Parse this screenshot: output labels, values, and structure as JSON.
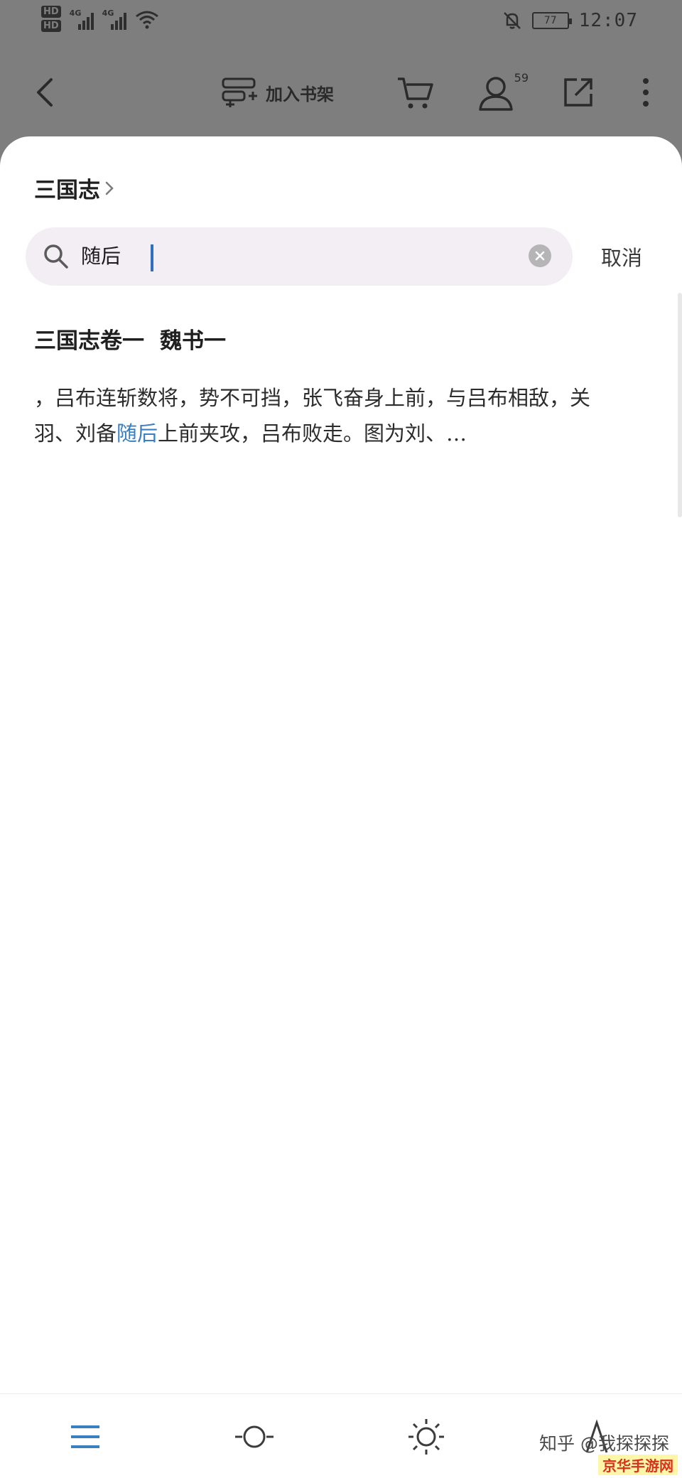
{
  "status_bar": {
    "hd1": "HD",
    "hd2": "HD",
    "net1": "4G",
    "net2": "4G",
    "battery": "77",
    "time": "12:07",
    "icons": [
      "signal-icon",
      "wifi-icon",
      "mute-bell-icon",
      "battery-icon"
    ]
  },
  "top_bar": {
    "add_shelf_label": "加入书架",
    "user_badge": "59",
    "icons": [
      "back-icon",
      "add-shelf-icon",
      "cart-icon",
      "user-icon",
      "share-icon",
      "more-icon"
    ]
  },
  "sheet": {
    "book_title": "三国志",
    "search": {
      "value": "随后",
      "cancel_label": "取消"
    },
    "result": {
      "title_part1": "三国志卷一",
      "title_part2": "魏书一",
      "snippet_before": "，吕布连斩数将，势不可挡，张飞奋身上前，与吕布相敌，关羽、刘备",
      "snippet_highlight": "随后",
      "snippet_after": "上前夹攻，吕布败走。图为刘、…"
    }
  },
  "bottom_bar": {
    "icons": [
      "menu-icon",
      "progress-icon",
      "brightness-icon",
      "font-icon"
    ]
  },
  "watermark": {
    "text": "知乎 @我探探探",
    "site": "京华手游网"
  },
  "colors": {
    "highlight": "#3a7fbf",
    "caret": "#2f6fbd",
    "menu_icon": "#3a7fbf",
    "overlay": "#7e7e7e"
  }
}
